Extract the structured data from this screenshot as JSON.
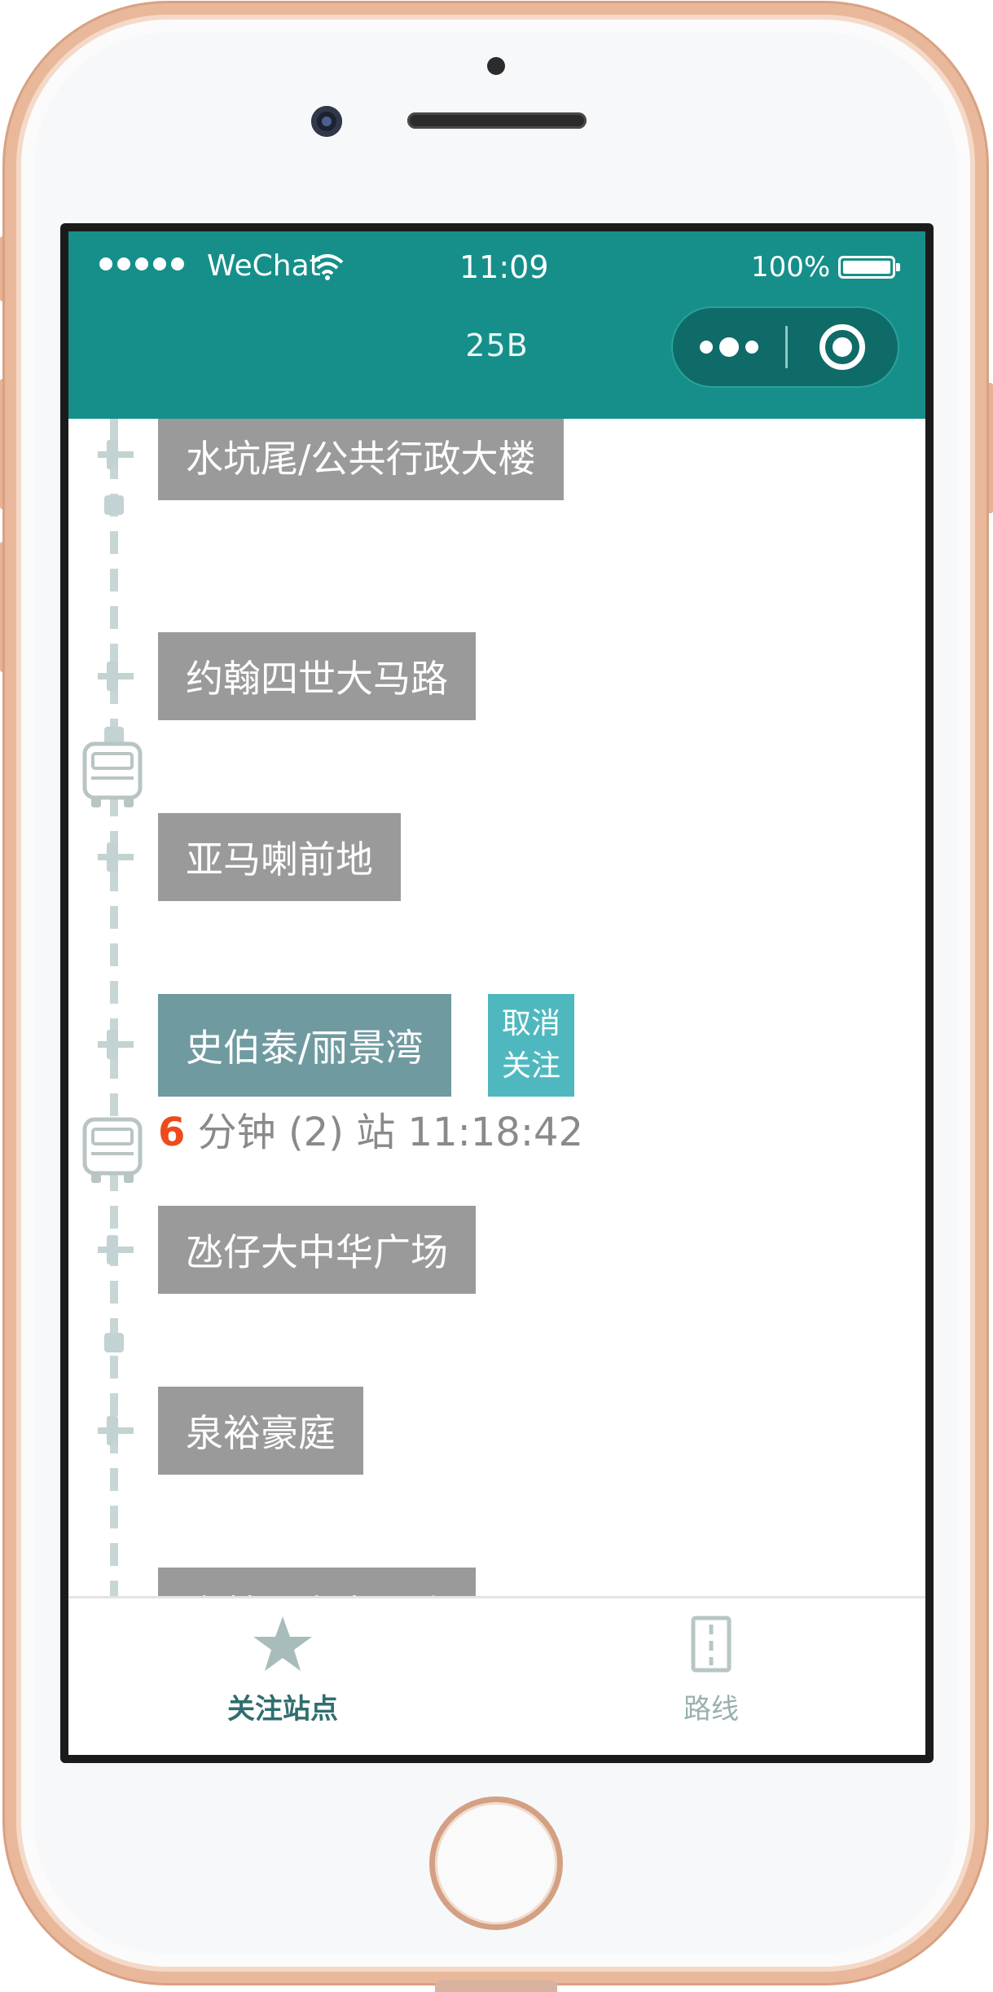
{
  "status_bar": {
    "carrier": "WeChat",
    "time": "11:09",
    "battery": "100%"
  },
  "nav": {
    "title": "25B"
  },
  "stops": [
    {
      "name": "水坑尾/公共行政大楼"
    },
    {
      "name": "约翰四世大马路"
    },
    {
      "name": "亚马喇前地"
    },
    {
      "name": "史伯泰/丽景湾",
      "followed": true,
      "unfollow_label": "取消关注"
    },
    {
      "name": "氹仔大中华广场"
    },
    {
      "name": "泉裕豪庭"
    },
    {
      "name": "奥林匹克大马路"
    }
  ],
  "arrival": {
    "minutes": "6",
    "minutes_unit": "分钟",
    "stops_away": "(2)",
    "stops_unit": "站",
    "time": "11:18:42"
  },
  "tabs": [
    {
      "label": "关注站点",
      "icon": "star-icon",
      "active": true
    },
    {
      "label": "路线",
      "icon": "route-icon",
      "active": false
    }
  ],
  "colors": {
    "accent": "#168f8a",
    "stop_label": "#9a9a9a",
    "followed_stop": "#6f9aa0",
    "unfollow_button": "#4fb8bf",
    "arrival_minutes": "#ee4a1c"
  }
}
